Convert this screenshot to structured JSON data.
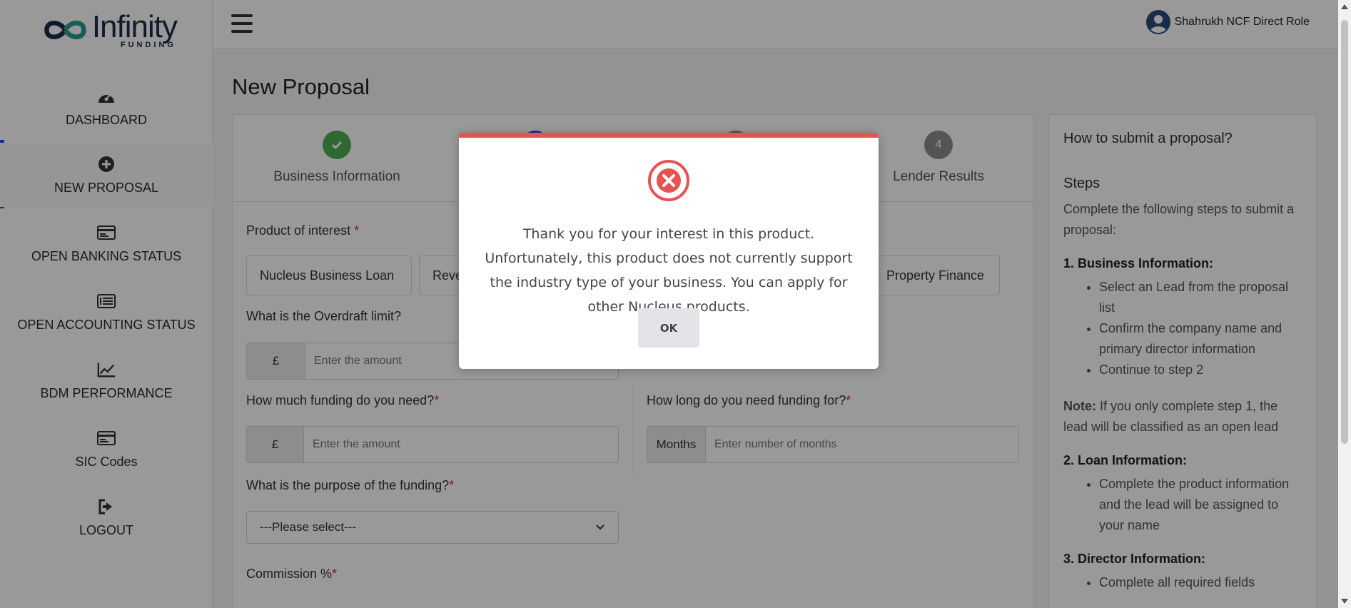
{
  "app": {
    "logo_word": "Infinity",
    "logo_sub": "FUNDING"
  },
  "sidebar": {
    "items": [
      {
        "label": "DASHBOARD",
        "icon": "dashboard-gauge-icon"
      },
      {
        "label": "NEW PROPOSAL",
        "icon": "plus-circle-icon",
        "active": true
      },
      {
        "label": "OPEN BANKING STATUS",
        "icon": "card-icon"
      },
      {
        "label": "OPEN ACCOUNTING STATUS",
        "icon": "list-icon"
      },
      {
        "label": "BDM PERFORMANCE",
        "icon": "line-chart-icon"
      },
      {
        "label": "SIC Codes",
        "icon": "card-icon"
      },
      {
        "label": "LOGOUT",
        "icon": "logout-icon"
      }
    ]
  },
  "header": {
    "user_name": "Shahrukh NCF Direct Role"
  },
  "page": {
    "title": "New Proposal"
  },
  "stepper": {
    "steps": [
      {
        "label": "Business Information",
        "state": "complete"
      },
      {
        "label": "",
        "state": "active"
      },
      {
        "label": "",
        "state": "pending"
      },
      {
        "label": "Lender Results",
        "number": "4",
        "state": "pending"
      }
    ]
  },
  "form": {
    "product_label": "Product of interest",
    "products": [
      "Nucleus Business Loan",
      "Reve",
      "Property Finance"
    ],
    "overdraft_label": "What is the Overdraft limit?",
    "overdraft_addon": "£",
    "overdraft_placeholder": "Enter the amount",
    "funding_label": "How much funding do you need?",
    "funding_addon": "£",
    "funding_placeholder": "Enter the amount",
    "duration_label": "How long do you need funding for?",
    "duration_addon": "Months",
    "duration_placeholder": "Enter number of months",
    "purpose_label": "What is the purpose of the funding?",
    "purpose_value": "---Please select---",
    "commission_label": "Commission %",
    "required_mark": "*"
  },
  "help": {
    "title": "How to submit a proposal?",
    "steps_heading": "Steps",
    "intro": "Complete the following steps to submit a proposal:",
    "section1": "1. Business Information:",
    "section1_items": [
      "Select an Lead from the proposal list",
      "Confirm the company name and primary director information",
      "Continue to step 2"
    ],
    "note_label": "Note:",
    "note_text": " If you only complete step 1, the lead will be classified as an open lead",
    "section2": "2. Loan Information:",
    "section2_items": [
      "Complete the product information and the lead will be assigned to your name"
    ],
    "section3": "3. Director Information:",
    "section3_items": [
      "Complete all required fields"
    ]
  },
  "modal": {
    "message": "Thank you for your interest in this product. Unfortunately, this product does not currently support the industry type of your business. You can apply for other Nucleus products.",
    "ok_label": "OK",
    "icon": "error-x-circle-icon",
    "accent_color": "#e55353"
  },
  "colors": {
    "active_nav": "#1e4fd8",
    "step_complete": "#4caf50",
    "step_active": "#1e4fd8",
    "step_pending": "#8c8c8c"
  }
}
